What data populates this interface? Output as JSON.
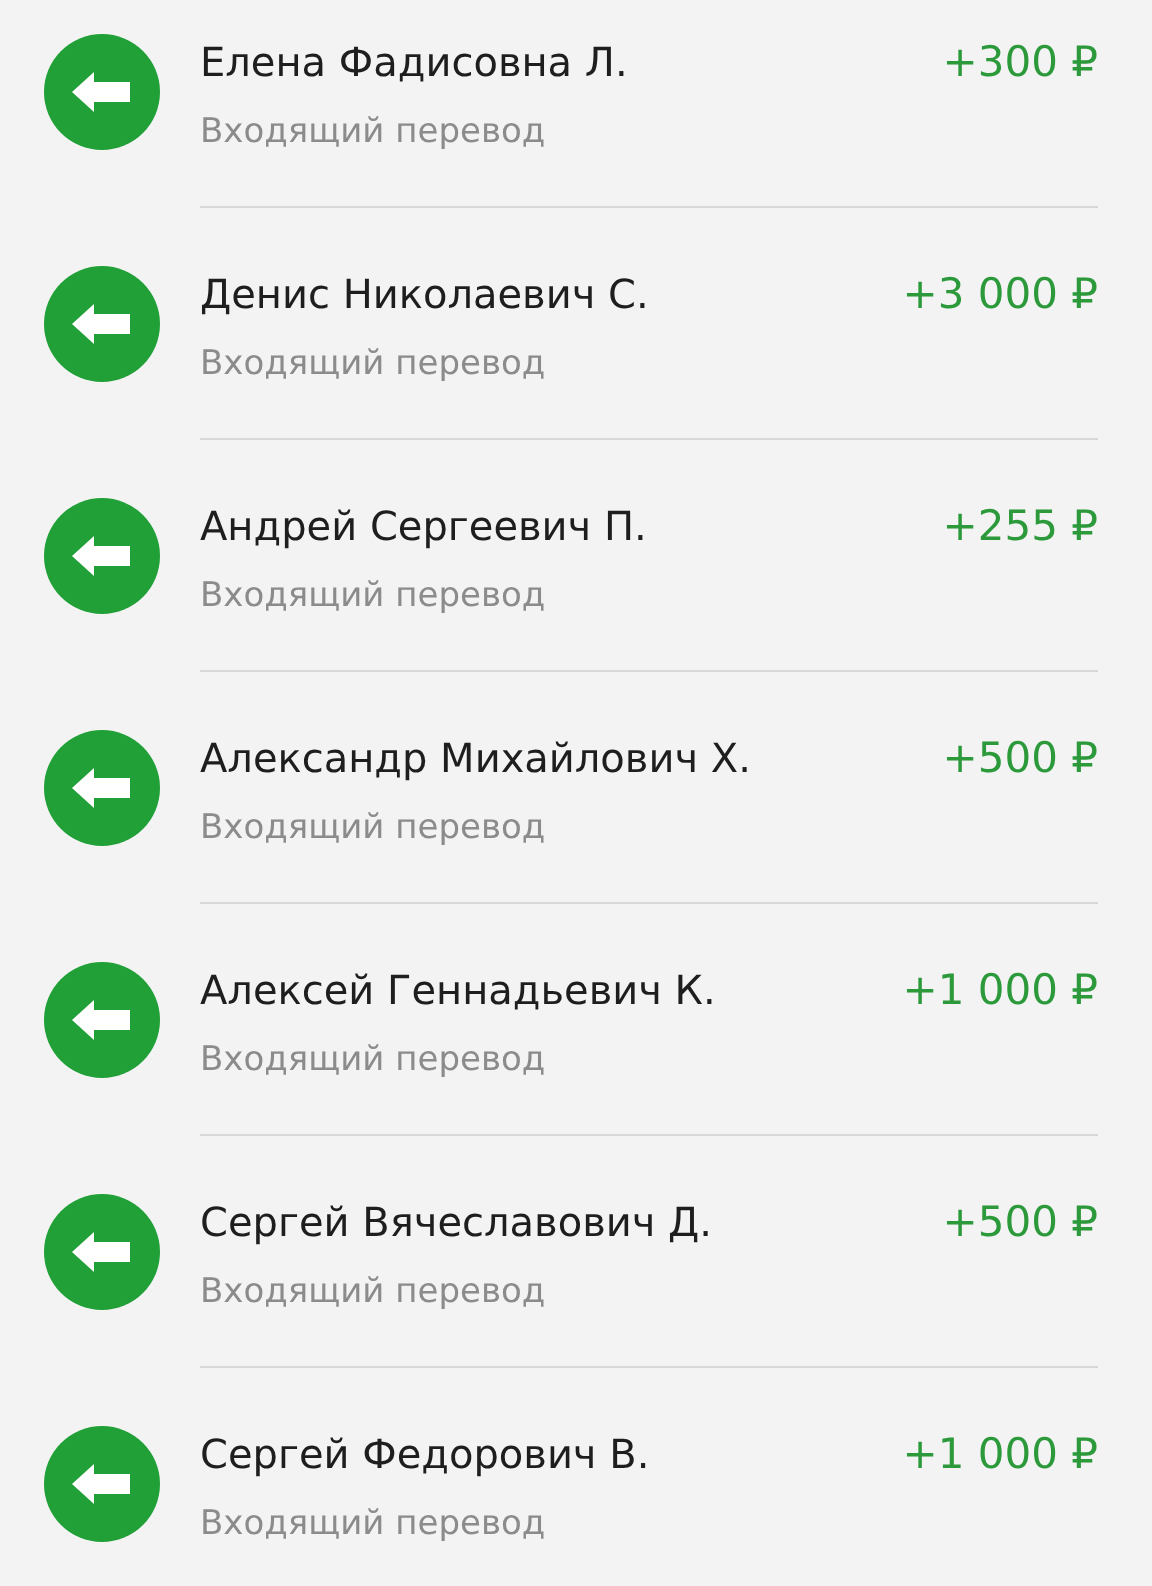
{
  "transactions": [
    {
      "name": "Елена Фадисовна Л.",
      "subtitle": "Входящий перевод",
      "amount": "+300 ₽"
    },
    {
      "name": "Денис Николаевич С.",
      "subtitle": "Входящий перевод",
      "amount": "+3 000 ₽"
    },
    {
      "name": "Андрей Сергеевич П.",
      "subtitle": "Входящий перевод",
      "amount": "+255 ₽"
    },
    {
      "name": "Александр Михайлович Х.",
      "subtitle": "Входящий перевод",
      "amount": "+500 ₽"
    },
    {
      "name": "Алексей Геннадьевич К.",
      "subtitle": "Входящий перевод",
      "amount": "+1 000 ₽"
    },
    {
      "name": "Сергей Вячеславович Д.",
      "subtitle": "Входящий перевод",
      "amount": "+500 ₽"
    },
    {
      "name": "Сергей Федорович В.",
      "subtitle": "Входящий перевод",
      "amount": "+1 000 ₽"
    }
  ]
}
